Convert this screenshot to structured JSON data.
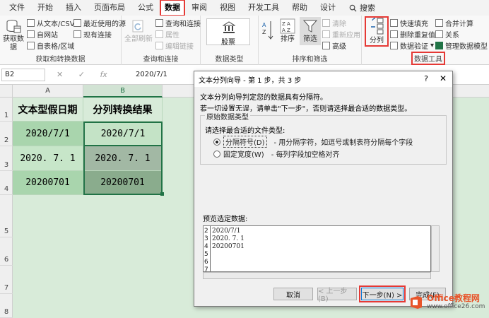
{
  "ribbon_tabs": [
    {
      "label": "文件"
    },
    {
      "label": "开始"
    },
    {
      "label": "插入"
    },
    {
      "label": "页面布局"
    },
    {
      "label": "公式"
    },
    {
      "label": "数据",
      "active": true
    },
    {
      "label": "审阅"
    },
    {
      "label": "视图"
    },
    {
      "label": "开发工具"
    },
    {
      "label": "帮助"
    },
    {
      "label": "设计"
    }
  ],
  "search_label": "搜索",
  "groups": {
    "get_data": {
      "get_data_btn": "获取数据",
      "from_text": "从文本/CSV",
      "from_web": "自网站",
      "from_table": "自表格/区域",
      "recent_sources": "最近使用的源",
      "existing": "现有连接",
      "label": "获取和转换数据"
    },
    "queries": {
      "refresh_all": "全部刷新",
      "queries_conn": "查询和连接",
      "properties": "属性",
      "edit_links": "编辑链接",
      "label": "查询和连接"
    },
    "data_types": {
      "stocks": "股票",
      "label": "数据类型"
    },
    "sort_filter": {
      "sort": "排序",
      "filter": "筛选",
      "clear": "清除",
      "reapply": "重新应用",
      "advanced": "高级",
      "label": "排序和筛选"
    },
    "data_tools": {
      "text_to_columns": "分列",
      "flash_fill": "快速填充",
      "remove_dup": "删除重复值",
      "validation": "数据验证",
      "consolidate": "合并计算",
      "relationships": "关系",
      "manage_model": "管理数据模型",
      "label": "数据工具"
    }
  },
  "name_box": "B2",
  "formula_value": "2020/7/1",
  "columns": [
    "A",
    "B"
  ],
  "rows": [
    "1",
    "2",
    "3",
    "4",
    "5",
    "6",
    "7",
    "8"
  ],
  "sheet": {
    "header_a": "文本型假日期",
    "header_b": "分列转换结果",
    "a_values": [
      "2020/7/1",
      "2020. 7. 1",
      "20200701"
    ],
    "b_values": [
      "2020/7/1",
      "2020. 7. 1",
      "20200701"
    ]
  },
  "dialog": {
    "title": "文本分列向导 - 第 1 步，共 3 步",
    "help": "?",
    "close": "✕",
    "line1": "文本分列向导判定您的数据具有分隔符。",
    "line2": "若一切设置无误，请单击\"下一步\"，否则请选择最合适的数据类型。",
    "fieldset_label": "原始数据类型",
    "choose": "请选择最合适的文件类型:",
    "opt1": "分隔符号(D)",
    "opt1_desc": "- 用分隔字符，如逗号或制表符分隔每个字段",
    "opt2": "固定宽度(W)",
    "opt2_desc": "- 每列字段加空格对齐",
    "preview_label": "预览选定数据:",
    "preview_nums": [
      "2",
      "3",
      "4",
      "5",
      "6",
      "7"
    ],
    "preview_rows": [
      "2020/7/1",
      "2020. 7. 1",
      "20200701"
    ],
    "cancel": "取消",
    "back": "< 上一步(B)",
    "next": "下一步(N) >",
    "finish": "完成(F)"
  },
  "watermark": {
    "brand": "Office教程网",
    "url": "www.office26.com"
  },
  "colors": {
    "accent": "#217346",
    "highlight": "#e53935",
    "sheet_bg": "#d8ebd9"
  }
}
